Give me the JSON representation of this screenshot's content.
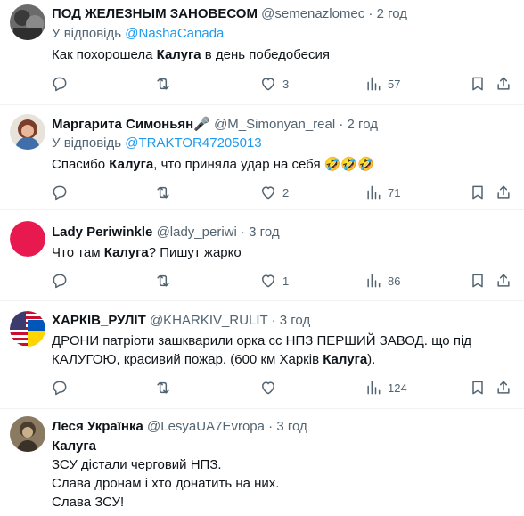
{
  "tweets": [
    {
      "name": "ПОД ЖЕЛЕЗНЫМ ЗАНОВЕСОМ",
      "handle": "@semenazlomec",
      "sep": "·",
      "time": "2 год",
      "reply_prefix": "У відповідь",
      "reply_to": "@NashaCanada",
      "lines": [
        [
          {
            "t": "Как похорошела "
          },
          {
            "t": "Калуга",
            "b": true
          },
          {
            "t": " в день победобесия"
          }
        ]
      ],
      "likes": "3",
      "views": "57"
    },
    {
      "name": "Маргарита Симоньян🎤",
      "handle": "@M_Simonyan_real",
      "sep": "·",
      "time": "2 год",
      "reply_prefix": "У відповідь",
      "reply_to": "@TRAKTOR47205013",
      "lines": [
        [
          {
            "t": "Спасибо "
          },
          {
            "t": "Калуга",
            "b": true
          },
          {
            "t": ", что приняла удар на себя 🤣🤣🤣"
          }
        ]
      ],
      "likes": "2",
      "views": "71"
    },
    {
      "name": "Lady Periwinkle",
      "handle": "@lady_periwi",
      "sep": "·",
      "time": "3 год",
      "lines": [
        [
          {
            "t": "Что там "
          },
          {
            "t": "Калуга",
            "b": true
          },
          {
            "t": "? Пишут жарко"
          }
        ]
      ],
      "likes": "1",
      "views": "86"
    },
    {
      "name": "ХАРКІВ_РУЛІТ",
      "handle": "@KHARKIV_RULIT",
      "sep": "·",
      "time": "3 год",
      "lines": [
        [
          {
            "t": "ДРОНИ патріоти зашкварили орка сс НПЗ ПЕРШИЙ ЗАВОД. що під"
          }
        ],
        [
          {
            "t": "КАЛУГОЮ, красивий пожар.  (600 км Харків "
          },
          {
            "t": "Калуга",
            "b": true
          },
          {
            "t": ")."
          }
        ]
      ],
      "likes": "",
      "views": "124"
    },
    {
      "name": "Леся Українка",
      "handle": "@LesyaUA7Evropa",
      "sep": "·",
      "time": "3 год",
      "lines": [
        [
          {
            "t": "Калуга",
            "b": true
          }
        ],
        [
          {
            "t": "ЗСУ дістали черговий НПЗ."
          }
        ],
        [
          {
            "t": "Слава дронам і хто донатить на них."
          }
        ],
        [
          {
            "t": "Слава ЗСУ!"
          }
        ]
      ]
    }
  ],
  "colors": {
    "text": "#0f1419",
    "secondary": "#536471",
    "link": "#1d9bf0",
    "divider": "#eff3f4"
  },
  "icons": {
    "reply": "reply-icon",
    "retweet": "retweet-icon",
    "like": "heart-icon",
    "views": "views-icon",
    "bookmark": "bookmark-icon",
    "share": "share-icon"
  }
}
